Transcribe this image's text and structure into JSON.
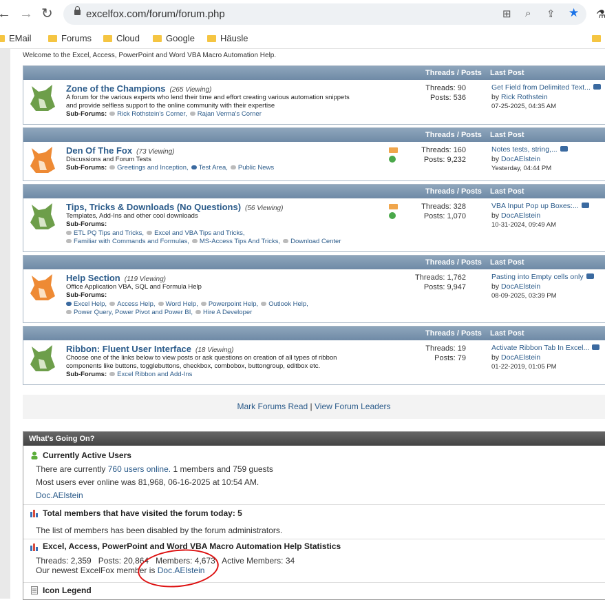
{
  "browser": {
    "url": "excelfox.com/forum/forum.php",
    "bookmarks": [
      "EMail",
      "Forums",
      "Cloud",
      "Google",
      "Häusle"
    ]
  },
  "welcome": "Welcome to the Excel, Access, PowerPoint and Word VBA Macro Automation Help.",
  "header_labels": {
    "threads_posts": "Threads / Posts",
    "last_post": "Last Post"
  },
  "forums": [
    {
      "title": "Zone of the Champions",
      "viewing": "(265 Viewing)",
      "desc": [
        "A forum for the various experts who lend their time and effort creating various automation snippets",
        "and provide selfless support to the online community with their expertise"
      ],
      "subs_label": "Sub-Forums:",
      "subs": [
        "Rick Rothstein's Corner,",
        "Rajan Verma's Corner"
      ],
      "threads": "Threads: 90",
      "posts": "Posts: 536",
      "last_title": "Get Field from Delimited Text...",
      "last_by": "by",
      "last_user": "Rick Rothstein",
      "last_date": "07-25-2025, 04:35 AM"
    },
    {
      "title": "Den Of The Fox",
      "viewing": "(73 Viewing)",
      "desc": [
        "Discussions and Forum Tests"
      ],
      "subs_label": "Sub-Forums:",
      "subs": [
        "Greetings and Inception,",
        "Test Area,",
        "Public News"
      ],
      "threads": "Threads: 160",
      "posts": "Posts: 9,232",
      "last_title": "Notes tests, string,...",
      "last_by": "by",
      "last_user": "DocAElstein",
      "last_date": "Yesterday, 04:44 PM"
    },
    {
      "title": "Tips, Tricks & Downloads (No Questions)",
      "viewing": "(56 Viewing)",
      "desc": [
        "Templates, Add-Ins and other cool downloads"
      ],
      "subs_label": "Sub-Forums:",
      "subs_line1": [
        "ETL PQ Tips and Tricks,",
        "Excel and VBA Tips and Tricks,"
      ],
      "subs_line2": [
        "Familiar with Commands and Formulas,",
        "MS-Access Tips And Tricks,",
        "Download Center"
      ],
      "threads": "Threads: 328",
      "posts": "Posts: 1,070",
      "last_title": "VBA Input Pop up Boxes:...",
      "last_by": "by",
      "last_user": "DocAElstein",
      "last_date": "10-31-2024, 09:49 AM"
    },
    {
      "title": "Help Section",
      "viewing": "(119 Viewing)",
      "desc": [
        "Office Application VBA, SQL and Formula Help"
      ],
      "subs_label": "Sub-Forums:",
      "subs_line1": [
        "Excel Help,",
        "Access Help,",
        "Word Help,",
        "Powerpoint Help,",
        "Outlook Help,"
      ],
      "subs_line2": [
        "Power Query, Power Pivot and Power BI,",
        "Hire A Developer"
      ],
      "threads": "Threads: 1,762",
      "posts": "Posts: 9,947",
      "last_title": "Pasting into Empty cells only",
      "last_by": "by",
      "last_user": "DocAElstein",
      "last_date": "08-09-2025, 03:39 PM"
    },
    {
      "title": "Ribbon: Fluent User Interface",
      "viewing": "(18 Viewing)",
      "desc": [
        "Choose one of the links below to view posts or ask questions on creation of all types of ribbon",
        "components like buttons, togglebuttons, checkbox, combobox, buttongroup, editbox etc."
      ],
      "subs_label": "Sub-Forums:",
      "subs": [
        "Excel Ribbon and Add-Ins"
      ],
      "threads": "Threads: 19",
      "posts": "Posts: 79",
      "last_title": "Activate Ribbon Tab In Excel...",
      "last_by": "by",
      "last_user": "DocAElstein",
      "last_date": "01-22-2019, 01:05 PM"
    }
  ],
  "footer_nav": {
    "mark_read": "Mark Forums Read",
    "sep": "|",
    "leaders": "View Forum Leaders"
  },
  "wgo": {
    "title": "What's Going On?",
    "active_title": "Currently Active Users",
    "active_pre": "There are currently",
    "active_link": "760 users online.",
    "active_post": "1 members and 759 guests",
    "most_users": "Most users ever online was 81,968, 06-16-2025 at 10:54 AM.",
    "active_member": "Doc.AElstein",
    "today_title": "Total members that have visited the forum today: 5",
    "today_text": "The list of members has been disabled by the forum administrators.",
    "stats_title": "Excel, Access, PowerPoint and Word VBA Macro Automation Help Statistics",
    "stats_line": "Threads: 2,359   Posts: 20,864   Members: 4,673   Active Members: 34",
    "newest_pre": "Our newest ExcelFox member is",
    "newest_user": "Doc.AElstein",
    "legend_title": "Icon Legend"
  },
  "colors": {
    "accent_link": "#2b5b8a",
    "header_blue": "#7891ab",
    "annotation_red": "#dd1111"
  }
}
